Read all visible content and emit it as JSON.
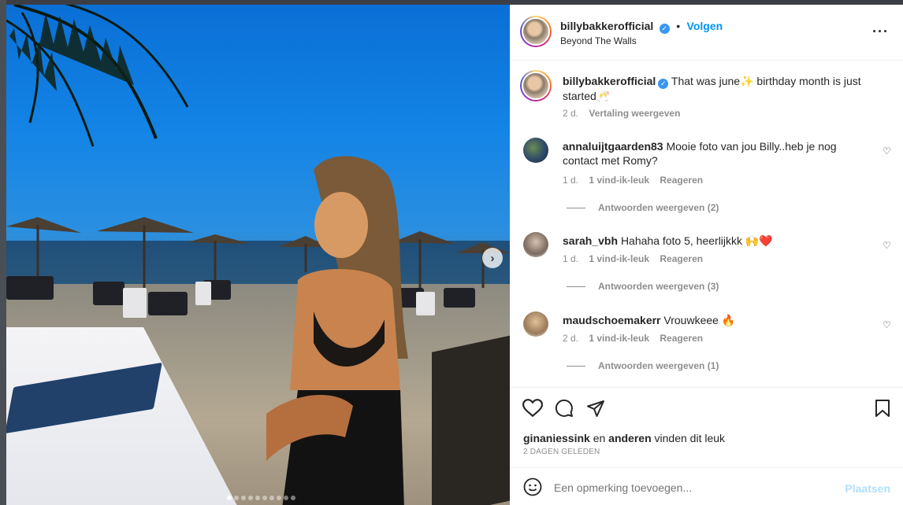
{
  "post": {
    "username": "billybakkerofficial",
    "follow_label": "Volgen",
    "separator": "•",
    "location": "Beyond The Walls",
    "more_icon": "more-horizontal-icon"
  },
  "caption": {
    "username": "billybakkerofficial",
    "text": "That was june✨ birthday month is just started🥂",
    "age": "2 d.",
    "translate_label": "Vertaling weergeven"
  },
  "comments": [
    {
      "username": "annaluijtgaarden83",
      "text": "Mooie foto van jou Billy..heb je nog contact met Romy?",
      "age": "1 d.",
      "likes": "1 vind-ik-leuk",
      "reply_label": "Reageren",
      "replies_label": "Antwoorden weergeven (2)"
    },
    {
      "username": "sarah_vbh",
      "text": "Hahaha foto 5, heerlijkkk 🙌❤️",
      "age": "1 d.",
      "likes": "1 vind-ik-leuk",
      "reply_label": "Reageren",
      "replies_label": "Antwoorden weergeven (3)"
    },
    {
      "username": "maudschoemakerr",
      "text": "Vrouwkeee 🔥",
      "age": "2 d.",
      "likes": "1 vind-ik-leuk",
      "reply_label": "Reageren",
      "replies_label": "Antwoorden weergeven (1)"
    }
  ],
  "likes_line": {
    "user": "ginaniessink",
    "rest": " en ",
    "others": "anderen",
    "suffix": " vinden dit leuk"
  },
  "timestamp": "2 DAGEN GELEDEN",
  "composer": {
    "placeholder": "Een opmerking toevoegen...",
    "post_label": "Plaatsen"
  },
  "carousel": {
    "slide_count": 10,
    "active_index": 0
  },
  "colors": {
    "accent": "#0095f6",
    "verified": "#3897f0",
    "text": "#262626",
    "muted": "#8e8e8e"
  }
}
